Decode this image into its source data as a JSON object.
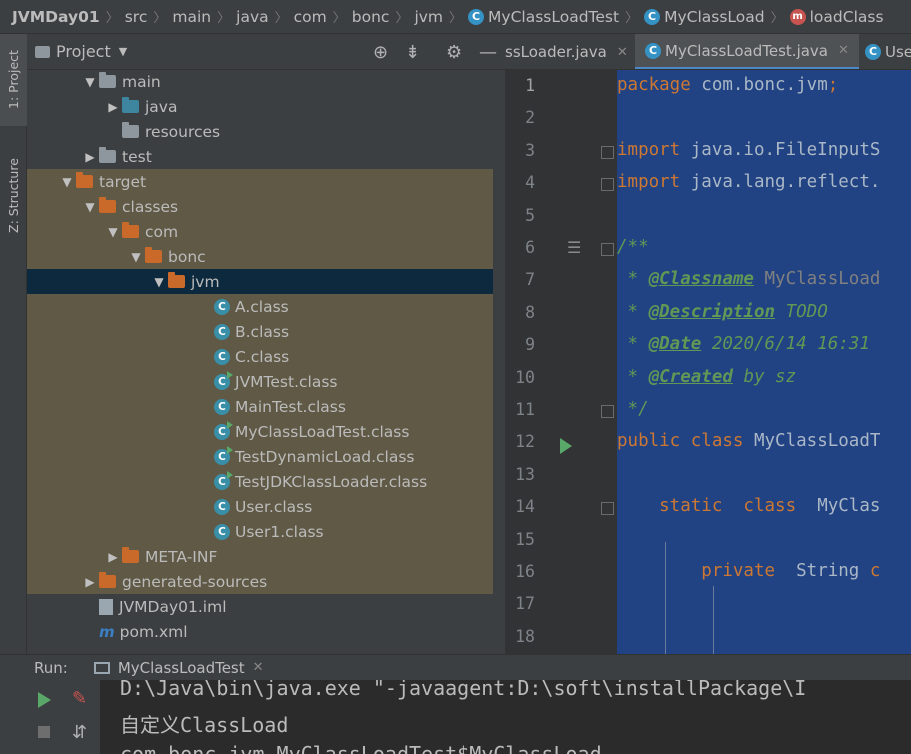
{
  "breadcrumbs": [
    {
      "label": "JVMDay01",
      "icon": ""
    },
    {
      "label": "src",
      "icon": ""
    },
    {
      "label": "main",
      "icon": ""
    },
    {
      "label": "java",
      "icon": ""
    },
    {
      "label": "com",
      "icon": ""
    },
    {
      "label": "bonc",
      "icon": ""
    },
    {
      "label": "jvm",
      "icon": ""
    },
    {
      "label": "MyClassLoadTest",
      "icon": "class-icon"
    },
    {
      "label": "MyClassLoad",
      "icon": "class-icon"
    },
    {
      "label": "loadClass",
      "icon": "method-icon"
    }
  ],
  "left_strip": {
    "project_tab": "1: Project",
    "structure_tab": "Z: Structure"
  },
  "project_panel": {
    "title": "Project",
    "tree": [
      {
        "label": "main",
        "depth": 2,
        "arrow": "down",
        "icon": "folder-grey",
        "state": "normal"
      },
      {
        "label": "java",
        "depth": 3,
        "arrow": "right",
        "icon": "folder-blue",
        "state": "normal"
      },
      {
        "label": "resources",
        "depth": 3,
        "arrow": "",
        "icon": "folder-res",
        "state": "normal"
      },
      {
        "label": "test",
        "depth": 2,
        "arrow": "right",
        "icon": "folder-grey",
        "state": "normal"
      },
      {
        "label": "target",
        "depth": 1,
        "arrow": "down",
        "icon": "folder-orange",
        "state": "excluded"
      },
      {
        "label": "classes",
        "depth": 2,
        "arrow": "down",
        "icon": "folder-orange",
        "state": "excluded"
      },
      {
        "label": "com",
        "depth": 3,
        "arrow": "down",
        "icon": "folder-orange",
        "state": "excluded"
      },
      {
        "label": "bonc",
        "depth": 4,
        "arrow": "down",
        "icon": "folder-orange",
        "state": "excluded"
      },
      {
        "label": "jvm",
        "depth": 5,
        "arrow": "down",
        "icon": "folder-orange",
        "state": "selected"
      },
      {
        "label": "A.class",
        "depth": 7,
        "arrow": "",
        "icon": "class",
        "state": "excluded"
      },
      {
        "label": "B.class",
        "depth": 7,
        "arrow": "",
        "icon": "class",
        "state": "excluded"
      },
      {
        "label": "C.class",
        "depth": 7,
        "arrow": "",
        "icon": "class",
        "state": "excluded"
      },
      {
        "label": "JVMTest.class",
        "depth": 7,
        "arrow": "",
        "icon": "class-run",
        "state": "excluded"
      },
      {
        "label": "MainTest.class",
        "depth": 7,
        "arrow": "",
        "icon": "class",
        "state": "excluded"
      },
      {
        "label": "MyClassLoadTest.class",
        "depth": 7,
        "arrow": "",
        "icon": "class-run",
        "state": "excluded"
      },
      {
        "label": "TestDynamicLoad.class",
        "depth": 7,
        "arrow": "",
        "icon": "class-run",
        "state": "excluded"
      },
      {
        "label": "TestJDKClassLoader.class",
        "depth": 7,
        "arrow": "",
        "icon": "class-run",
        "state": "excluded"
      },
      {
        "label": "User.class",
        "depth": 7,
        "arrow": "",
        "icon": "class",
        "state": "excluded"
      },
      {
        "label": "User1.class",
        "depth": 7,
        "arrow": "",
        "icon": "class",
        "state": "excluded"
      },
      {
        "label": "META-INF",
        "depth": 3,
        "arrow": "right",
        "icon": "folder-orange",
        "state": "excluded"
      },
      {
        "label": "generated-sources",
        "depth": 2,
        "arrow": "right",
        "icon": "folder-orange",
        "state": "excluded"
      },
      {
        "label": "JVMDay01.iml",
        "depth": 2,
        "arrow": "",
        "icon": "iml-file",
        "state": "normal"
      },
      {
        "label": "pom.xml",
        "depth": 2,
        "arrow": "",
        "icon": "maven-file",
        "state": "normal"
      }
    ]
  },
  "editor": {
    "tabs": [
      {
        "label": "ssLoader.java",
        "active": false
      },
      {
        "label": "MyClassLoadTest.java",
        "active": true
      },
      {
        "label": "Use",
        "active": false
      }
    ],
    "line_numbers": [
      "1",
      "2",
      "3",
      "4",
      "5",
      "6",
      "7",
      "8",
      "9",
      "10",
      "11",
      "12",
      "13",
      "14",
      "15",
      "16",
      "17",
      "18"
    ],
    "code_lines": [
      [
        {
          "t": "package",
          "c": "kw"
        },
        {
          "t": " com.bonc.jvm",
          "c": ""
        },
        {
          "t": ";",
          "c": "kw"
        }
      ],
      [],
      [
        {
          "t": "import",
          "c": "kw"
        },
        {
          "t": " java.io.FileInputS",
          "c": ""
        }
      ],
      [
        {
          "t": "import",
          "c": "kw"
        },
        {
          "t": " java.lang.reflect.",
          "c": ""
        }
      ],
      [],
      [
        {
          "t": "/**",
          "c": "cm"
        }
      ],
      [
        {
          "t": " * ",
          "c": "cm"
        },
        {
          "t": "@Classname",
          "c": "tag"
        },
        {
          "t": " MyClassLoad",
          "c": "gry"
        }
      ],
      [
        {
          "t": " * ",
          "c": "cm"
        },
        {
          "t": "@Description",
          "c": "tag"
        },
        {
          "t": " TODO",
          "c": "cm"
        }
      ],
      [
        {
          "t": " * ",
          "c": "cm"
        },
        {
          "t": "@Date",
          "c": "tag"
        },
        {
          "t": " 2020/6/14 16:31",
          "c": "cm"
        }
      ],
      [
        {
          "t": " * ",
          "c": "cm"
        },
        {
          "t": "@Created",
          "c": "tag"
        },
        {
          "t": " by sz",
          "c": "cm"
        }
      ],
      [
        {
          "t": " */",
          "c": "cm"
        }
      ],
      [
        {
          "t": "public class",
          "c": "kw"
        },
        {
          "t": " MyClassLoadT",
          "c": ""
        }
      ],
      [],
      [
        {
          "t": "    static  class",
          "c": "kw"
        },
        {
          "t": "  MyClas",
          "c": ""
        }
      ],
      [],
      [
        {
          "t": "        private",
          "c": "kw"
        },
        {
          "t": "  String ",
          "c": ""
        },
        {
          "t": "c",
          "c": "kw"
        }
      ],
      [],
      []
    ]
  },
  "run_panel": {
    "label": "Run:",
    "tab_label": "MyClassLoadTest",
    "console_lines": [
      "D:\\Java\\bin\\java.exe \"-javaagent:D:\\soft\\installPackage\\I",
      "自定义ClassLoad",
      "com.bonc.jvm.MyClassLoadTest$MyClassLoad"
    ]
  },
  "colors": {
    "panel_bg": "#3c3f41",
    "selection_bg": "#214283",
    "excluded_bg": "#5f5946",
    "selected_row_bg": "#0d293e",
    "keyword": "#cc7832",
    "doc_comment": "#629755"
  }
}
